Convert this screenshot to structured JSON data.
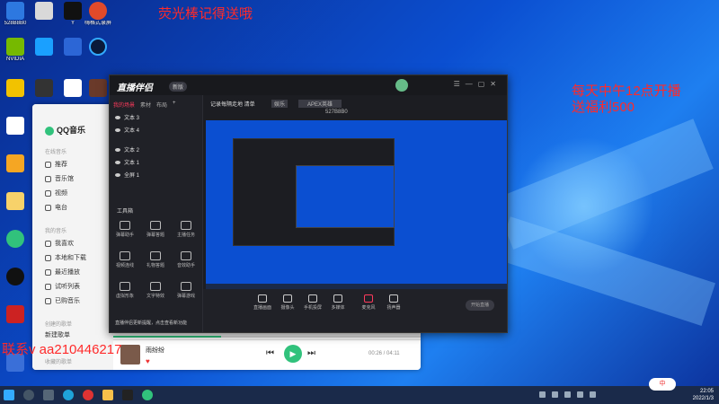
{
  "desktop": {
    "icons_col1": [
      "528B8B0",
      "NVIDIA",
      "",
      "",
      "",
      "",
      ""
    ],
    "icons_top": [
      "",
      "",
      "Y",
      "嗨格式录屏"
    ],
    "overlay_top": "荧光棒记得送哦",
    "overlay_right_line1": "每天中午12点开播",
    "overlay_right_line2": "送福利500",
    "overlay_left_contact": "联系v  aa210446217"
  },
  "qq_music": {
    "logo": "QQ音乐",
    "section_online": "在线音乐",
    "online_items": [
      "推荐",
      "音乐馆",
      "视频",
      "电台"
    ],
    "section_mine": "我的音乐",
    "mine_items": [
      "我喜欢",
      "本地和下载",
      "最近播放",
      "试听列表",
      "已购音乐"
    ],
    "section_created": "创建的歌单",
    "created_item": "新建歌单",
    "section_collected": "收藏的歌单",
    "progress": 0.35,
    "now_playing": "雨纷纷",
    "time": "00:26 / 04:11"
  },
  "stream_app": {
    "logo": "直播伴侣",
    "badge": "新版",
    "tabs": [
      "我的场景",
      "素材",
      "布局"
    ],
    "scenes": [
      "文本 3",
      "文本 4",
      "文本 2",
      "文本 1",
      "全屏 1"
    ],
    "tools_title": "工具箱",
    "tools": [
      "弹幕助手",
      "弹幕答题",
      "主播任务",
      "视频连线",
      "礼物答题",
      "音效助手",
      "虚拟形象",
      "文字特效",
      "弹幕游戏"
    ],
    "room_title": "记录每隔走地 清单",
    "tag": "娱乐",
    "category": "APEX英雄",
    "stats": "527B8B0",
    "controls": [
      "直播画面",
      "摄像头",
      "手机投屏",
      "多媒体",
      "麦克风",
      "扬声器"
    ],
    "go_live": "开始直播",
    "notice": "直播伴侣更新提醒，点击查看新功能"
  },
  "taskbar": {
    "time": "22:05",
    "date": "2022/1/3",
    "ime": "中"
  }
}
